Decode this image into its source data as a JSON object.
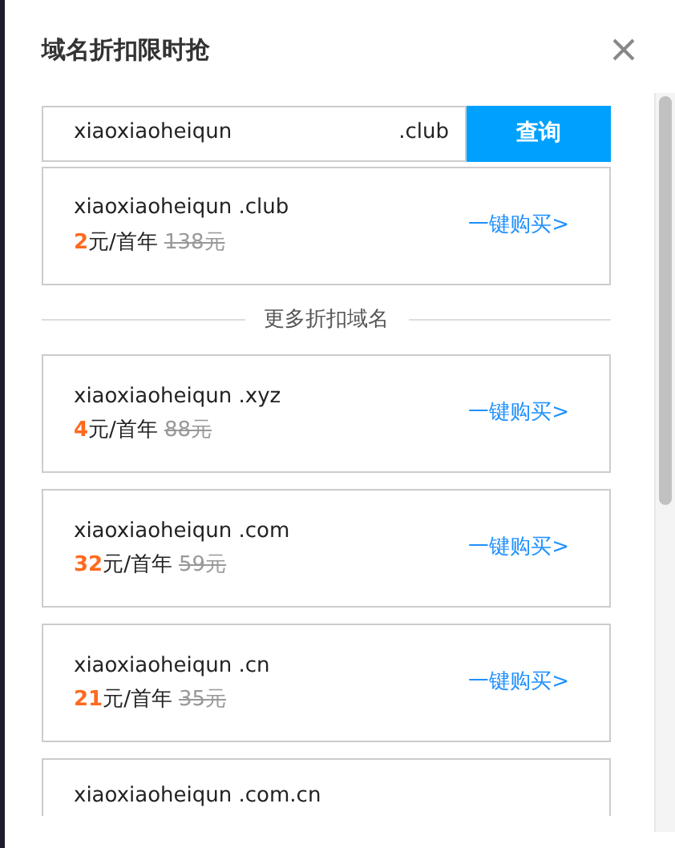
{
  "dialog": {
    "title": "域名折扣限时抢"
  },
  "search": {
    "value": "xiaoxiaoheiqun",
    "suffix": ".club",
    "button": "查询"
  },
  "result": {
    "domain": "xiaoxiaoheiqun .club",
    "price": "2",
    "unit": "元/首年",
    "original": "138元",
    "buy": "一键购买>"
  },
  "more_heading": "更多折扣域名",
  "offers": [
    {
      "domain": "xiaoxiaoheiqun .xyz",
      "price": "4",
      "unit": "元/首年",
      "original": "88元",
      "buy": "一键购买>"
    },
    {
      "domain": "xiaoxiaoheiqun .com",
      "price": "32",
      "unit": "元/首年",
      "original": "59元",
      "buy": "一键购买>"
    },
    {
      "domain": "xiaoxiaoheiqun .cn",
      "price": "21",
      "unit": "元/首年",
      "original": "35元",
      "buy": "一键购买>"
    },
    {
      "domain": "xiaoxiaoheiqun .com.cn"
    }
  ]
}
